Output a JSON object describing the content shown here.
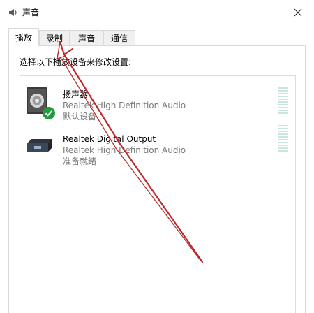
{
  "window": {
    "title": "声音",
    "close_icon": "close-icon",
    "app_icon": "speaker-icon"
  },
  "tabs": [
    {
      "label": "播放",
      "active": true
    },
    {
      "label": "录制",
      "active": false
    },
    {
      "label": "声音",
      "active": false
    },
    {
      "label": "通信",
      "active": false
    }
  ],
  "instruction": "选择以下播放设备来修改设置:",
  "devices": [
    {
      "name": "扬声器",
      "description": "Realtek High Definition Audio",
      "status": "默认设备",
      "icon": "speaker-icon",
      "badge": "checkmark-icon"
    },
    {
      "name": "Realtek Digital Output",
      "description": "Realtek High Definition Audio",
      "status": "准备就绪",
      "icon": "digital-output-icon"
    }
  ],
  "annotation": {
    "color": "#c0282a"
  }
}
